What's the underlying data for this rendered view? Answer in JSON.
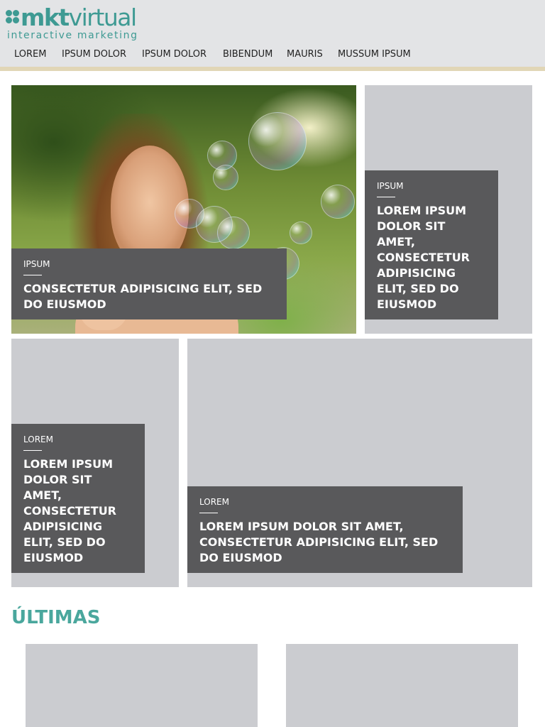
{
  "brand": {
    "logo_word_bold": "mkt",
    "logo_word_light": "virtual",
    "tagline": "interactive marketing",
    "color": "#3e9a93"
  },
  "nav": {
    "items": [
      "LOREM",
      "IPSUM DOLOR",
      "IPSUM DOLOR",
      "BIBENDUM",
      "MAURIS",
      "MUSSUM IPSUM"
    ]
  },
  "tiles": [
    {
      "category": "IPSUM",
      "title": "CONSECTETUR ADIPISICING ELIT, SED DO EIUSMOD"
    },
    {
      "category": "IPSUM",
      "title": "LOREM IPSUM DOLOR SIT AMET, CONSECTETUR ADIPISICING ELIT, SED DO EIUSMOD"
    },
    {
      "category": "LOREM",
      "title": "LOREM IPSUM DOLOR SIT AMET, CONSECTETUR ADIPISICING ELIT, SED DO EIUSMOD"
    },
    {
      "category": "LOREM",
      "title": "LOREM IPSUM DOLOR SIT AMET, CONSECTETUR ADIPISICING ELIT, SED DO EIUSMOD"
    }
  ],
  "latest": {
    "heading": "ÚLTIMAS",
    "accent": "#4aa79d"
  },
  "colors": {
    "header_bg": "#e3e4e6",
    "header_rule": "#e1d6b6",
    "tile_bg": "#cbccd0",
    "caption_bg": "#59595b"
  }
}
